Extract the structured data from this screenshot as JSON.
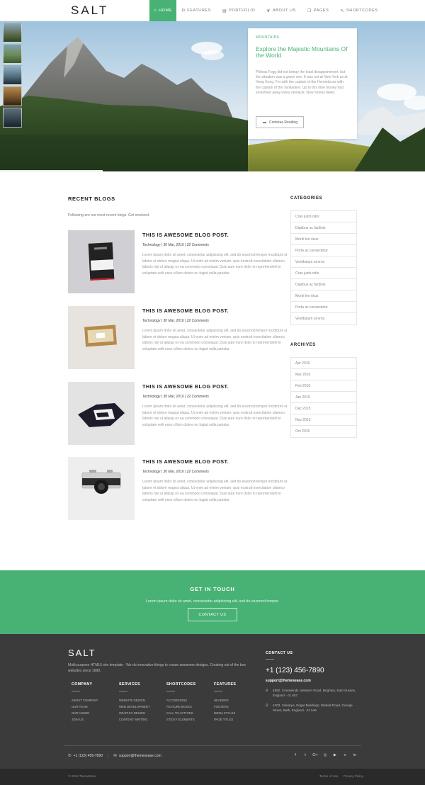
{
  "brand": "SALT",
  "nav": [
    {
      "label": "HOME",
      "icon": "home-icon",
      "glyph": "⌂",
      "active": true
    },
    {
      "label": "FEATURES",
      "icon": "features-icon",
      "glyph": "◘"
    },
    {
      "label": "PORTFOLIO",
      "icon": "portfolio-icon",
      "glyph": "▤"
    },
    {
      "label": "ABOUT US",
      "icon": "about-icon",
      "glyph": "❦"
    },
    {
      "label": "PAGES",
      "icon": "pages-icon",
      "glyph": "❐"
    },
    {
      "label": "SHORTCODES",
      "icon": "shortcodes-icon",
      "glyph": "✎"
    }
  ],
  "hero": {
    "category": "MOUNTAINS",
    "title": "Explore the Majestic Mountains Of the World",
    "text": "Phileas Fogg did not betray the least disappointment; but the situation was a grave one. It was not at New York as at Hong Kong. For with the captain of the Henrietta as with the captain of the Tankadere. Up to this time money had smoothed away every obstacle. Now money failed.",
    "button": "Continue Reading"
  },
  "blogs": {
    "heading": "RECENT BLOGS",
    "subheading": "Following are our most recent blogs. Get involved.",
    "posts": [
      {
        "title": "THIS IS AWESOME BLOG POST.",
        "category": "Technology",
        "date": "30 Mar, 2016",
        "comments": "22 Comments",
        "meta": "Technology  |  30 Mar, 2016  |  22 Comments",
        "body": "Lorem ipsum dolor sit amet, consectetur adipisicing elit, sed do eiusmod tempor incididunt ut labore et dolore magna aliqua. Ut enim ad minim veniam, quis nostrud exercitation ullamco laboris nisi ut aliquip ex ea commodo consequat. Duis aute irure dolor in reprehenderit in voluptate velit esse cillum dolore eu fugiat nulla pariatur."
      },
      {
        "title": "THIS IS AWESOME BLOG POST.",
        "category": "Technology",
        "date": "30 Mar, 2016",
        "comments": "22 Comments",
        "meta": "Technology  |  30 Mar, 2016  |  22 Comments",
        "body": "Lorem ipsum dolor sit amet, consectetur adipisicing elit, sed do eiusmod tempor incididunt ut labore et dolore magna aliqua. Ut enim ad minim veniam, quis nostrud exercitation ullamco laboris nisi ut aliquip ex ea commodo consequat. Duis aute irure dolor in reprehenderit in voluptate velit esse cillum dolore eu fugiat nulla pariatur."
      },
      {
        "title": "THIS IS AWESOME BLOG POST.",
        "category": "Technology",
        "date": "30 Mar, 2016",
        "comments": "22 Comments",
        "meta": "Technology  |  30 Mar, 2016  |  22 Comments",
        "body": "Lorem ipsum dolor sit amet, consectetur adipisicing elit, sed do eiusmod tempor incididunt ut labore et dolore magna aliqua. Ut enim ad minim veniam, quis nostrud exercitation ullamco laboris nisi ut aliquip ex ea commodo consequat. Duis aute irure dolor in reprehenderit in voluptate velit esse cillum dolore eu fugiat nulla pariatur."
      },
      {
        "title": "THIS IS AWESOME BLOG POST.",
        "category": "Technology",
        "date": "30 Mar, 2016",
        "comments": "22 Comments",
        "meta": "Technology  |  30 Mar, 2016  |  22 Comments",
        "body": "Lorem ipsum dolor sit amet, consectetur adipisicing elit, sed do eiusmod tempor incididunt ut labore et dolore magna aliqua. Ut enim ad minim veniam, quis nostrud exercitation ullamco laboris nisi ut aliquip ex ea commodo consequat. Duis aute irure dolor in reprehenderit in voluptate velit esse cillum dolore eu fugiat nulla pariatur."
      }
    ]
  },
  "categories": {
    "heading": "CATEGORIES",
    "items": [
      "Cras justo odio",
      "Dapibus ac facilisis",
      "Morbi leo risus",
      "Porta ac consectetur",
      "Vestibulum at eros",
      "Cras justo odio",
      "Dapibus ac facilisis",
      "Morbi leo risus",
      "Porta ac consectetur",
      "Vestibulum at eros"
    ]
  },
  "archives": {
    "heading": "ARCHIVES",
    "items": [
      "Apr 2016",
      "Mar 2016",
      "Feb 2016",
      "Jan 2016",
      "Dec 2015",
      "Nov 2015",
      "Oct 2015"
    ]
  },
  "touch": {
    "title": "GET IN TOUCH",
    "text": "Lorem ipsum dolor sit amet, consectetur adipisicing elit, sed do eiusmod tempor.",
    "button": "CONTACT US"
  },
  "footer": {
    "logo": "SALT",
    "description": "Multi-purpose HTML5 site template - We do innovative things to create awesome designs. Creating out of the box websites since 1999.",
    "columns": [
      {
        "heading": "COMPANY",
        "links": [
          "ABOUT COMPANY",
          "OUR TEAM",
          "OUR VISION",
          "JOIN US"
        ]
      },
      {
        "heading": "SERVICES",
        "links": [
          "WEBSITE DESIGN",
          "WEB DEVELOPMENT",
          "GRAPHIC DESIGN",
          "CONTENT WRITING"
        ]
      },
      {
        "heading": "SHORTCODES",
        "links": [
          "ACCORDIONS",
          "FEATURE BOXES",
          "CALL TO ACTIONS",
          "STICKY ELEMENTS"
        ]
      },
      {
        "heading": "FEATURES",
        "links": [
          "HEADERS",
          "FOOTERS",
          "MENU STYLES",
          "PAGE TITLES"
        ]
      }
    ],
    "contact": {
      "heading": "CONTACT US",
      "phone": "+1 (123) 456-7890",
      "email": "support@themesease.com",
      "address1": "4992, Crosswinds, Western Road, Brighton, East Sussex, England - 01 657",
      "address2": "4203, Sdwarya, Edgar Buildings, Walsall Road, George Street, Bath, England - 01 546"
    },
    "bottom_phone": "+1 (123) 456-7890",
    "bottom_email": "support@themesease.com",
    "socials": [
      "f",
      "t",
      "G+",
      "◎",
      "▶",
      "v",
      "in"
    ],
    "copyright": "© 2016 ThemeEase",
    "links": [
      "Terms of Use",
      "Privacy Policy"
    ]
  }
}
